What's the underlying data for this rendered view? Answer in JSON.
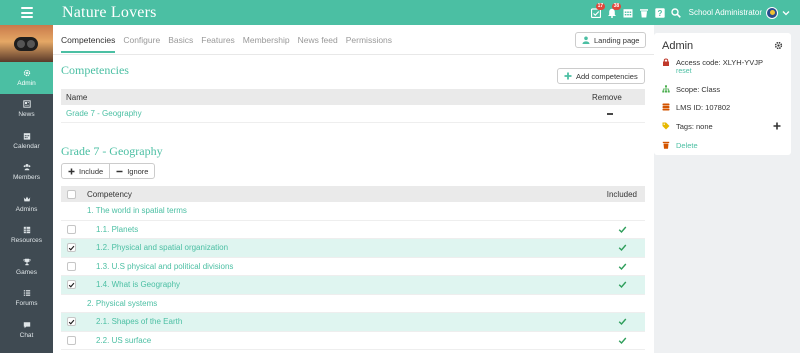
{
  "app": {
    "title": "Nature Lovers"
  },
  "topbar": {
    "badges": {
      "tasks": "17",
      "notifications": "38"
    },
    "user_label": "School Administrator"
  },
  "sidebar": {
    "items": [
      {
        "label": "Admin",
        "icon": "gear-icon",
        "active": true
      },
      {
        "label": "News",
        "icon": "newspaper-icon"
      },
      {
        "label": "Calendar",
        "icon": "calendar-icon"
      },
      {
        "label": "Members",
        "icon": "members-icon"
      },
      {
        "label": "Admins",
        "icon": "crown-icon"
      },
      {
        "label": "Resources",
        "icon": "resources-icon"
      },
      {
        "label": "Games",
        "icon": "trophy-icon"
      },
      {
        "label": "Forums",
        "icon": "list-icon"
      },
      {
        "label": "Chat",
        "icon": "chat-icon"
      }
    ]
  },
  "tabs": [
    "Competencies",
    "Configure",
    "Basics",
    "Features",
    "Membership",
    "News feed",
    "Permissions"
  ],
  "buttons": {
    "landing_page": "Landing page",
    "add_competencies": "Add competencies",
    "include": "Include",
    "ignore": "Ignore"
  },
  "competencies_section": {
    "title": "Competencies",
    "columns": {
      "name": "Name",
      "remove": "Remove"
    },
    "rows": [
      {
        "name": "Grade 7 - Geography"
      }
    ]
  },
  "geography_section": {
    "title": "Grade 7 - Geography",
    "columns": {
      "competency": "Competency",
      "included": "Included"
    },
    "rows": [
      {
        "label": "1. The world in spatial terms",
        "level": 1,
        "checkbox": false,
        "checked": false,
        "included": false
      },
      {
        "label": "1.1. Planets",
        "level": 2,
        "checkbox": true,
        "checked": false,
        "included": true
      },
      {
        "label": "1.2. Physical and spatial organization",
        "level": 2,
        "checkbox": true,
        "checked": true,
        "included": true
      },
      {
        "label": "1.3. U.S physical and political divisions",
        "level": 2,
        "checkbox": true,
        "checked": false,
        "included": true
      },
      {
        "label": "1.4. What is Geography",
        "level": 2,
        "checkbox": true,
        "checked": true,
        "included": true
      },
      {
        "label": "2. Physical systems",
        "level": 1,
        "checkbox": false,
        "checked": false,
        "included": false
      },
      {
        "label": "2.1. Shapes of the Earth",
        "level": 2,
        "checkbox": true,
        "checked": true,
        "included": true
      },
      {
        "label": "2.2. US surface",
        "level": 2,
        "checkbox": true,
        "checked": false,
        "included": true
      }
    ]
  },
  "admin_panel": {
    "title": "Admin",
    "access_code": "Access code: XLYH-YVJP",
    "reset": "reset",
    "scope": "Scope: Class",
    "lms_id": "LMS ID: 107802",
    "tags": "Tags: none",
    "delete": "Delete"
  },
  "colors": {
    "accent": "#4bbfa3",
    "sidebar": "#3f4a52",
    "badge": "#e0463a",
    "selected_row": "#dff5f0"
  }
}
